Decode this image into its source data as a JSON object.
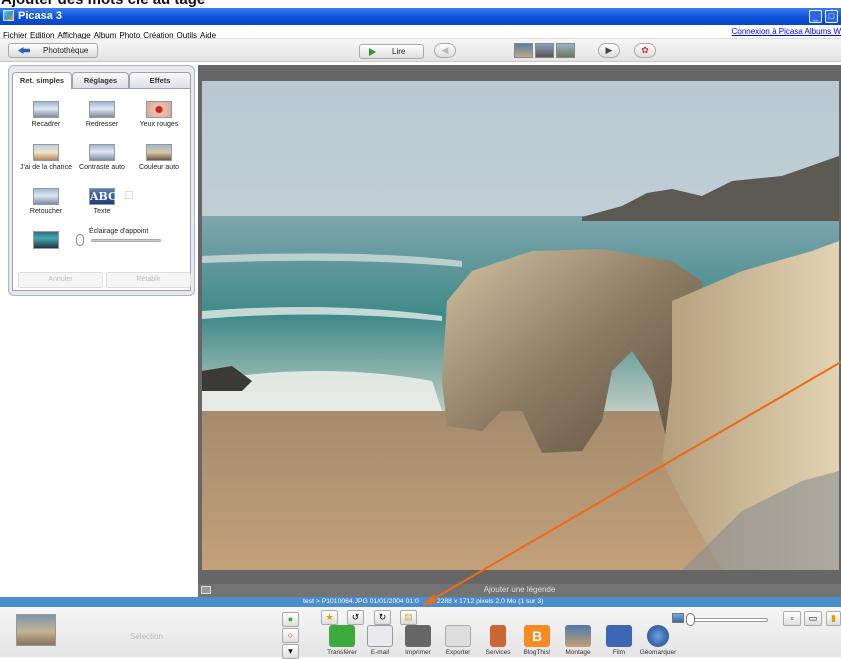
{
  "banner": "Ajouter des mots clé au tage",
  "window": {
    "title": "Picasa 3"
  },
  "menu": [
    "Fichier",
    "Edition",
    "Affichage",
    "Album",
    "Photo",
    "Création",
    "Outils",
    "Aide"
  ],
  "picasa_link": "Connexion à Picasa Albums W",
  "toolbar": {
    "back_label": "Photothèque",
    "play_label": "Lire"
  },
  "tabs": [
    "Ret. simples",
    "Réglages",
    "Effets"
  ],
  "tools": {
    "crop": "Recadrer",
    "straighten": "Redresser",
    "redeye": "Yeux rouges",
    "lucky": "J'ai de la chance",
    "auto_contrast": "Contraste auto",
    "auto_color": "Couleur auto",
    "retouch": "Retoucher",
    "text": "Texte",
    "text_icon": "ABC",
    "fill_light": "Éclairage d'appoint",
    "undo": "Annuler",
    "redo": "Rétablir"
  },
  "caption_placeholder": "Ajouter une légende",
  "status": "test > P1010064.JPG    01/01/2004 01:0",
  "status2": "2288 x 1712 pixels    2,0 Mo    (1 sur 3)",
  "selection_label": "Sélection",
  "actions": [
    "Transférer",
    "E-mail",
    "Imprimer",
    "Exporter",
    "Services",
    "BlogThis!",
    "Montage",
    "Film",
    "Géomarquer"
  ],
  "colors": {
    "accent": "#4a8ed0",
    "arrow": "#ef6a14",
    "title_bar": "#0a4fd8"
  },
  "icons": [
    "app-icon",
    "back-arrow-icon",
    "play-icon",
    "prev-icon",
    "next-icon",
    "star-icon",
    "rotate-left-icon",
    "rotate-right-icon",
    "upload-icon",
    "email-icon",
    "print-icon",
    "folder-icon",
    "blogger-icon",
    "globe-icon"
  ]
}
